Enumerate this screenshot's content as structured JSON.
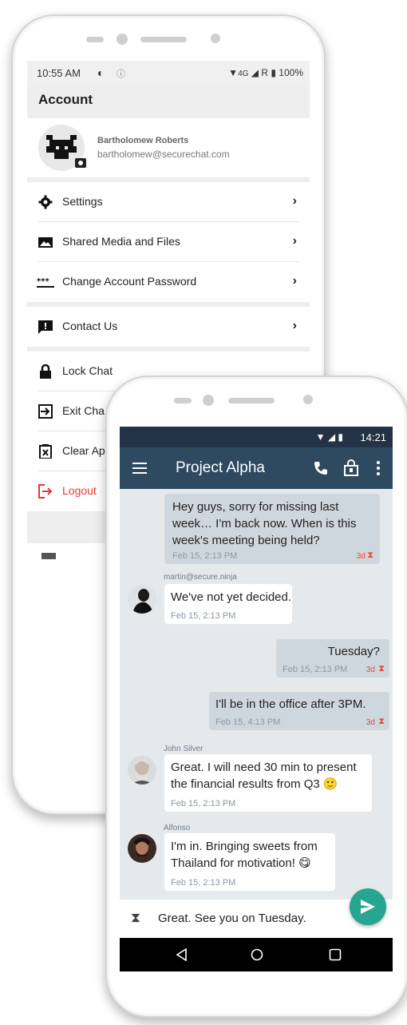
{
  "account_screen": {
    "status_bar": {
      "time": "10:55 AM",
      "network": "4G",
      "roaming": "R",
      "battery": "100%"
    },
    "header_title": "Account",
    "profile": {
      "name": "Bartholomew Roberts",
      "email": "bartholomew@securechat.com"
    },
    "menu_group1": [
      {
        "label": "Settings",
        "icon": "gear-icon"
      },
      {
        "label": "Shared Media and Files",
        "icon": "image-icon"
      },
      {
        "label": "Change Account Password",
        "icon": "password-icon"
      }
    ],
    "menu_group2": [
      {
        "label": "Contact Us",
        "icon": "feedback-icon"
      }
    ],
    "menu_group3": [
      {
        "label": "Lock Chat",
        "icon": "lock-icon"
      },
      {
        "label": "Exit Cha",
        "icon": "exit-icon"
      },
      {
        "label": "Clear Ap",
        "icon": "clear-icon"
      },
      {
        "label": "Logout",
        "icon": "logout-icon",
        "color": "#e53935"
      }
    ]
  },
  "chat_screen": {
    "status_bar": {
      "time": "14:21"
    },
    "title": "Project Alpha",
    "accent": "#2e4a61",
    "fab_color": "#26a690",
    "messages": [
      {
        "dir": "out",
        "text": "Hey guys, sorry for missing last week… I'm back now. When is this week's meeting being held?",
        "time": "Feb 15, 2:13 PM",
        "ttl": "3d"
      },
      {
        "dir": "in",
        "sender": "martin@secure.ninja",
        "text": "We've not yet decided.",
        "time": "Feb 15, 2:13 PM"
      },
      {
        "dir": "out",
        "text": "Tuesday?",
        "time": "Feb 15, 2:13 PM",
        "ttl": "3d"
      },
      {
        "dir": "out",
        "text": "I'll be in the office after 3PM.",
        "time": "Feb 15, 4:13 PM",
        "ttl": "3d"
      },
      {
        "dir": "in",
        "sender": "John Silver",
        "text": "Great. I will need 30 min to present the financial results from Q3 🙂",
        "time": "Feb 15, 2:13 PM"
      },
      {
        "dir": "in",
        "sender": "Alfonso",
        "text": "I'm in. Bringing sweets from Thailand for motivation! 😋",
        "time": "Feb 15, 2:13 PM"
      }
    ],
    "compose_value": "Great. See you on Tuesday."
  }
}
